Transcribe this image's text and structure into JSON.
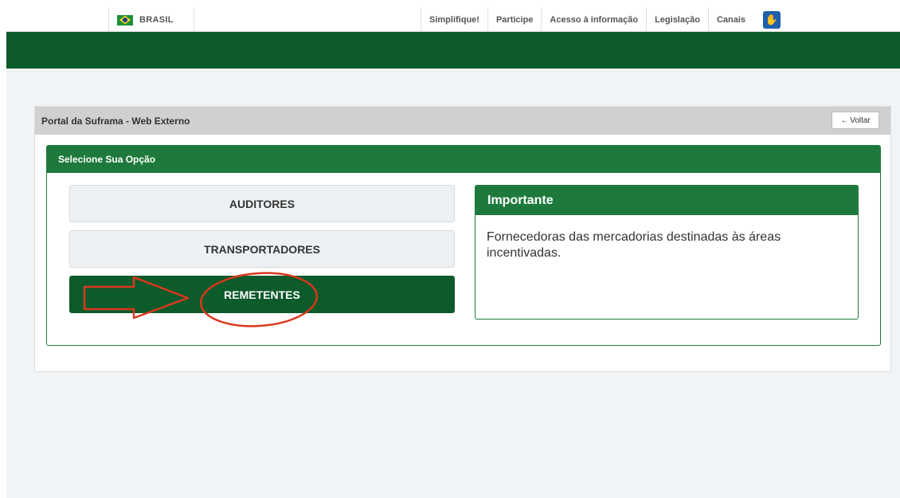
{
  "govbar": {
    "brasil_label": "BRASIL",
    "links": [
      "Simplifique!",
      "Participe",
      "Acesso à informação",
      "Legislação",
      "Canais"
    ]
  },
  "panel": {
    "title": "Portal da Suframa - Web Externo",
    "back_label": "Voltar"
  },
  "options": {
    "title": "Selecione Sua Opção",
    "items": [
      "AUDITORES",
      "TRANSPORTADORES",
      "REMETENTES"
    ],
    "selected": "REMETENTES"
  },
  "important": {
    "title": "Importante",
    "text": "Fornecedoras das mercadorias destinadas às áreas incentivadas."
  },
  "colors": {
    "dark_green": "#0d5a2b",
    "green": "#1e7a3c",
    "annotation_red": "#d9381e"
  }
}
